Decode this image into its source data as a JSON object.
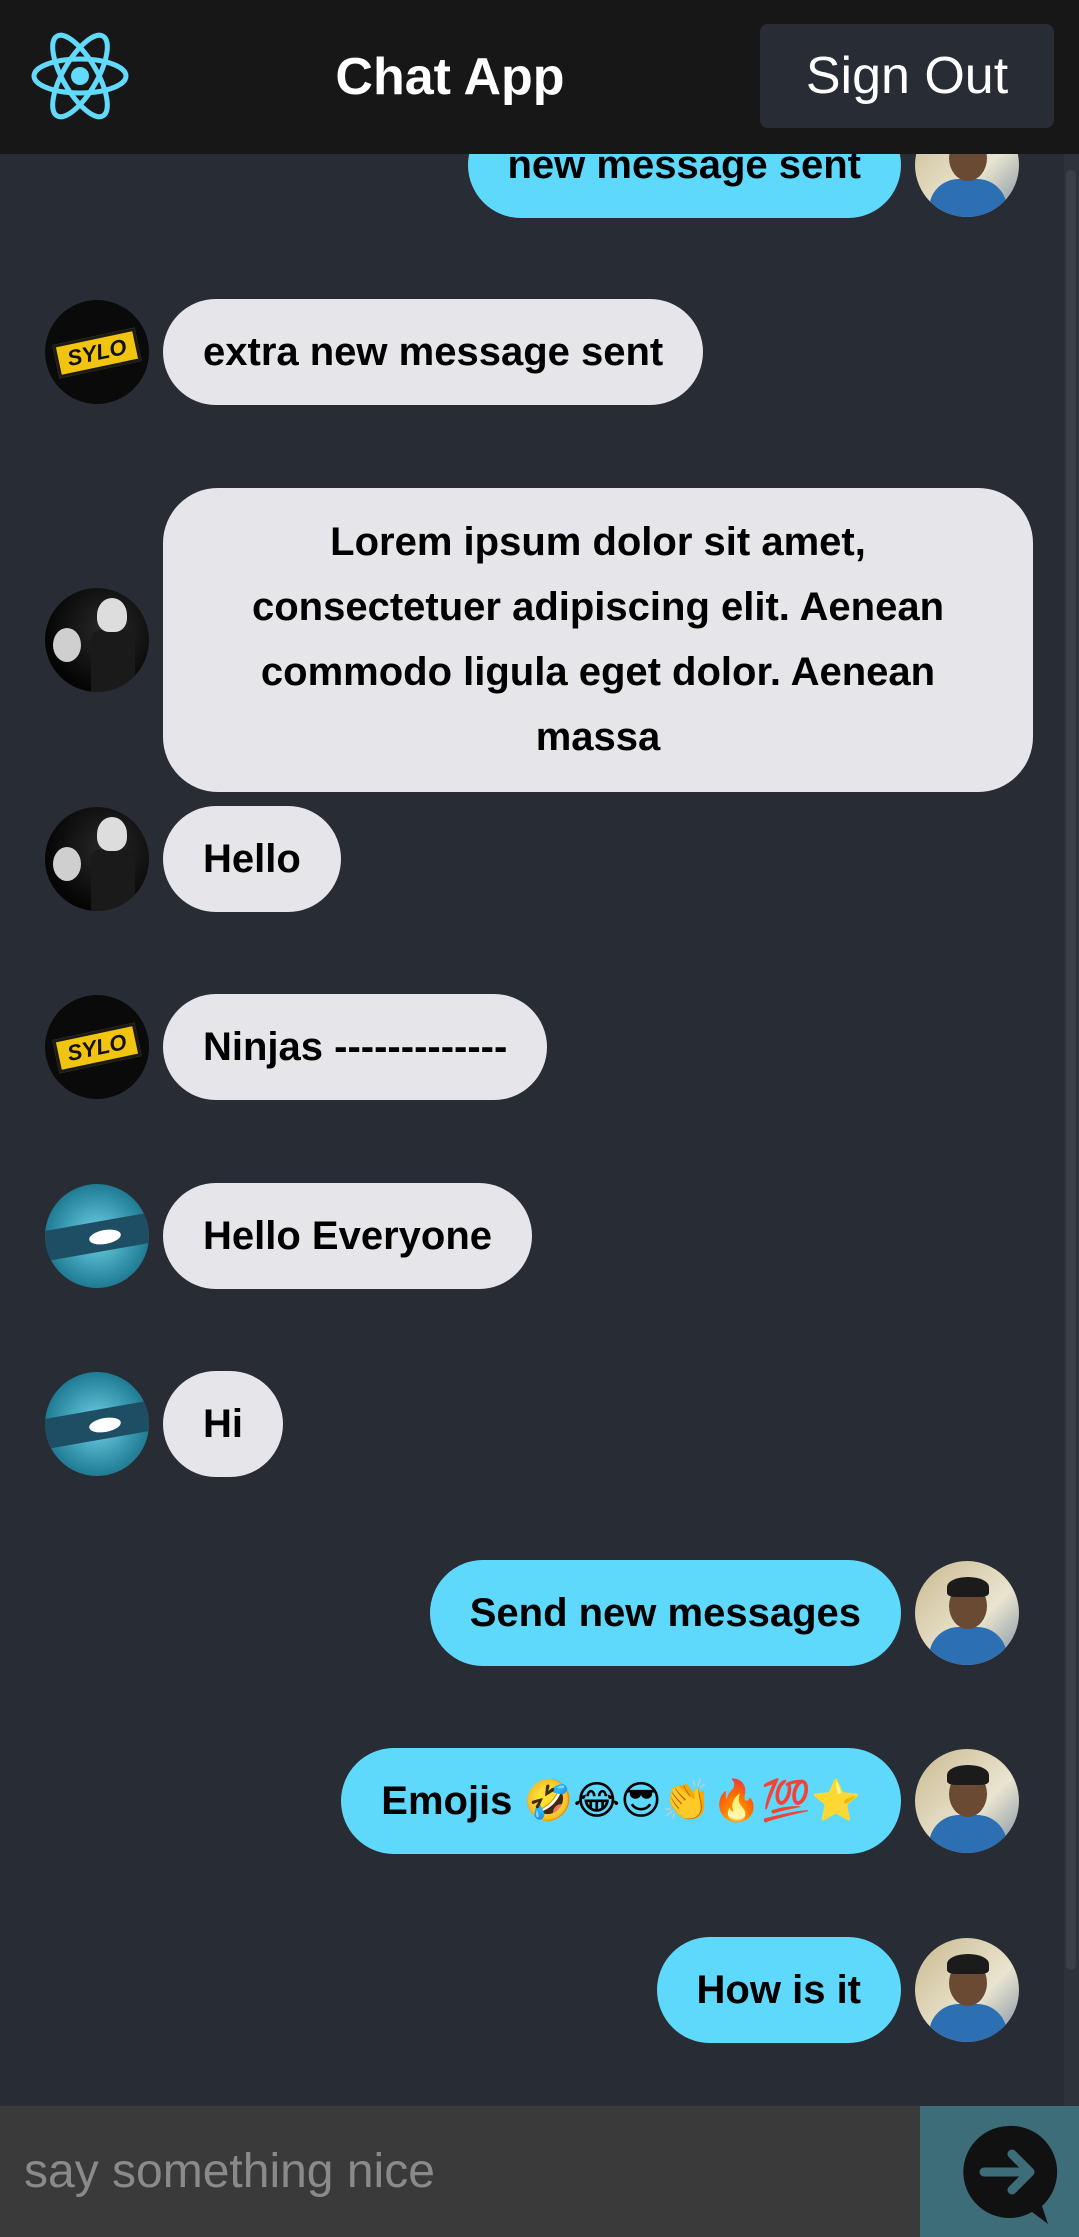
{
  "header": {
    "title": "Chat App",
    "sign_out_label": "Sign Out",
    "logo_icon": "react-atom-icon",
    "logo_color": "#61dafb"
  },
  "messages": [
    {
      "side": "sent",
      "text": "new message sent",
      "avatar": "user-photo"
    },
    {
      "side": "received",
      "text": "extra new message sent",
      "avatar": "sylo-logo"
    },
    {
      "side": "received",
      "text": "Lorem ipsum dolor sit amet, consectetuer adipiscing elit. Aenean commodo ligula eget dolor. Aenean massa",
      "avatar": "dark-figure"
    },
    {
      "side": "received",
      "text": "Hello",
      "avatar": "dark-figure"
    },
    {
      "side": "received",
      "text": "Ninjas -------------",
      "avatar": "sylo-logo"
    },
    {
      "side": "received",
      "text": "Hello Everyone",
      "avatar": "ninja-eye"
    },
    {
      "side": "received",
      "text": "Hi",
      "avatar": "ninja-eye"
    },
    {
      "side": "sent",
      "text": "Send new messages",
      "avatar": "user-photo"
    },
    {
      "side": "sent",
      "text": "Emojis 🤣😂😎👏🔥💯⭐",
      "avatar": "user-photo"
    },
    {
      "side": "sent",
      "text": "How is it",
      "avatar": "user-photo"
    }
  ],
  "composer": {
    "placeholder": "say something nice",
    "value": "",
    "send_icon": "arrow-right-circle-icon"
  },
  "colors": {
    "background": "#282c34",
    "header": "#181717",
    "sent_bubble": "#5fd9fb",
    "received_bubble": "#e5e5ea",
    "input_bar": "#3a3a3a",
    "send_button": "#3e6d7a"
  }
}
